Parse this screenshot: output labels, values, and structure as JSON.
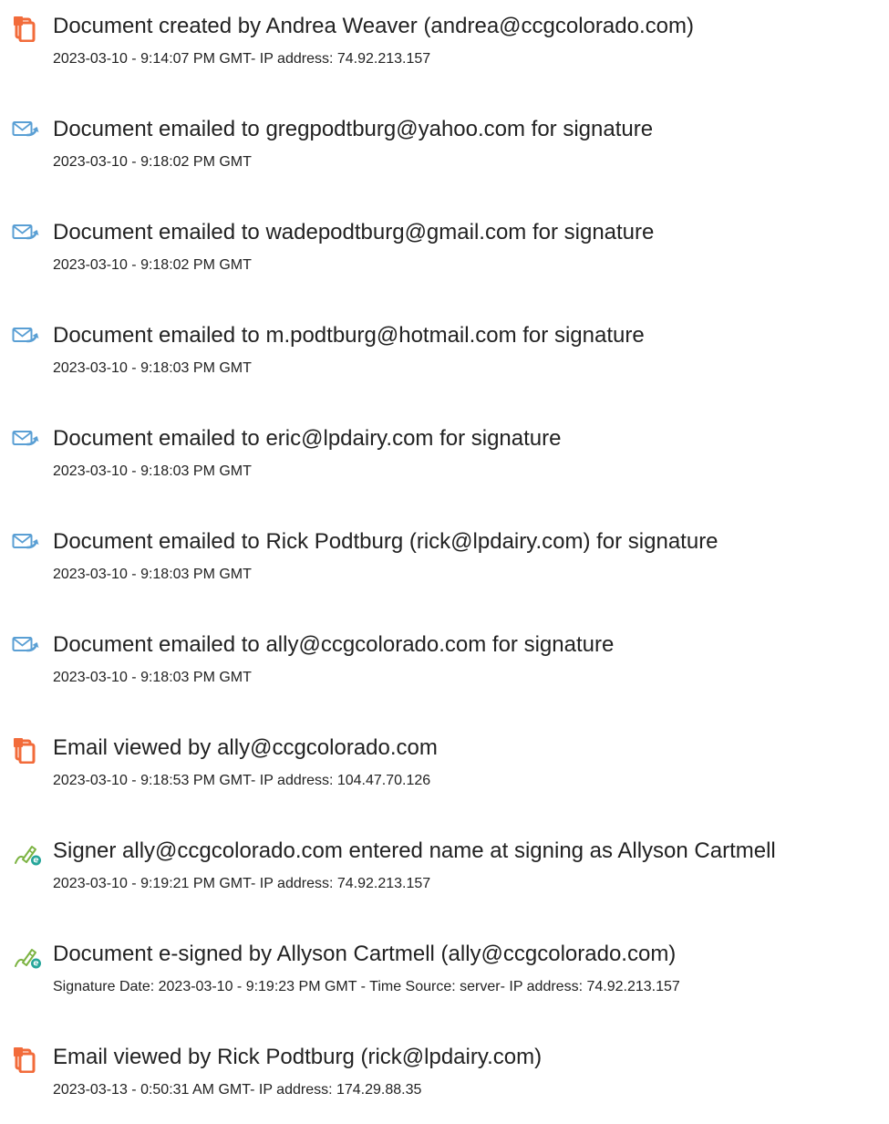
{
  "events": [
    {
      "icon": "document-icon",
      "title": "Document created by Andrea Weaver (andrea@ccgcolorado.com)",
      "meta": "2023-03-10 - 9:14:07 PM GMT- IP address: 74.92.213.157"
    },
    {
      "icon": "email-sent-icon",
      "title": "Document emailed to gregpodtburg@yahoo.com for signature",
      "meta": "2023-03-10 - 9:18:02 PM GMT"
    },
    {
      "icon": "email-sent-icon",
      "title": "Document emailed to wadepodtburg@gmail.com for signature",
      "meta": "2023-03-10 - 9:18:02 PM GMT"
    },
    {
      "icon": "email-sent-icon",
      "title": "Document emailed to m.podtburg@hotmail.com for signature",
      "meta": "2023-03-10 - 9:18:03 PM GMT"
    },
    {
      "icon": "email-sent-icon",
      "title": "Document emailed to eric@lpdairy.com for signature",
      "meta": "2023-03-10 - 9:18:03 PM GMT"
    },
    {
      "icon": "email-sent-icon",
      "title": "Document emailed to Rick Podtburg (rick@lpdairy.com) for signature",
      "meta": "2023-03-10 - 9:18:03 PM GMT"
    },
    {
      "icon": "email-sent-icon",
      "title": "Document emailed to ally@ccgcolorado.com for signature",
      "meta": "2023-03-10 - 9:18:03 PM GMT"
    },
    {
      "icon": "document-icon",
      "title": "Email viewed by ally@ccgcolorado.com",
      "meta": "2023-03-10 - 9:18:53 PM GMT- IP address: 104.47.70.126"
    },
    {
      "icon": "esign-pen-icon",
      "title": "Signer ally@ccgcolorado.com entered name at signing as Allyson Cartmell",
      "meta": "2023-03-10 - 9:19:21 PM GMT- IP address: 74.92.213.157"
    },
    {
      "icon": "esign-pen-icon",
      "title": "Document e-signed by Allyson Cartmell (ally@ccgcolorado.com)",
      "meta": "Signature Date: 2023-03-10 - 9:19:23 PM GMT - Time Source: server- IP address: 74.92.213.157"
    },
    {
      "icon": "document-icon",
      "title": "Email viewed by Rick Podtburg (rick@lpdairy.com)",
      "meta": "2023-03-13 - 0:50:31 AM GMT- IP address: 174.29.88.35"
    }
  ],
  "colors": {
    "document_icon": "#f26b3a",
    "email_icon": "#5a9fd4",
    "esign_pen": "#7cb342",
    "esign_badge": "#26a69a"
  }
}
